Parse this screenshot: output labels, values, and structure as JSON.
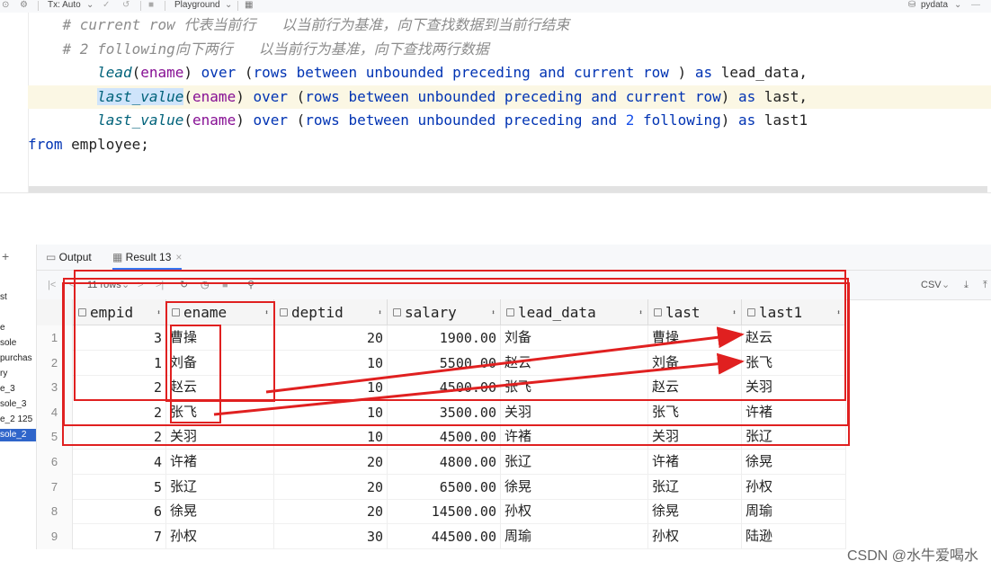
{
  "toolbar": {
    "tx_mode": "Tx: Auto",
    "playground": "Playground",
    "datasource": "pydata"
  },
  "editor": {
    "comment1": "    # current row 代表当前行   以当前行为基准，向下查找数据到当前行结束",
    "comment2": "    # 2 following向下两行   以当前行为基准，向下查找两行数据",
    "line3": {
      "fn": "lead",
      "arg": "ename",
      "kw_over": "over",
      "rows": "rows",
      "between": "between",
      "unbounded": "unbounded",
      "preceding": "preceding",
      "and": "and",
      "current_row": "current row",
      "as": "as",
      "alias": "lead_data,"
    },
    "line4": {
      "fn": "last_value",
      "arg": "ename",
      "alias": "last,"
    },
    "line5": {
      "fn": "last_value",
      "arg": "ename",
      "num": "2",
      "following": "following",
      "alias": "last1"
    },
    "line6": {
      "from": "from",
      "table": "employee;"
    }
  },
  "left_panel": {
    "items": [
      "st",
      "e",
      "sole",
      "purchas",
      "ry",
      "e_3",
      "sole_3",
      "e_2 125",
      "sole_2"
    ]
  },
  "tabs": {
    "output": "Output",
    "result": "Result 13"
  },
  "gridbar": {
    "rows": "11 rows",
    "export": "CSV"
  },
  "columns": [
    "empid",
    "ename",
    "deptid",
    "salary",
    "lead_data",
    "last",
    "last1"
  ],
  "rows": [
    {
      "n": "1",
      "empid": "3",
      "ename": "曹操",
      "deptid": "20",
      "salary": "1900.00",
      "lead_data": "刘备",
      "last": "曹操",
      "last1": "赵云"
    },
    {
      "n": "2",
      "empid": "1",
      "ename": "刘备",
      "deptid": "10",
      "salary": "5500.00",
      "lead_data": "赵云",
      "last": "刘备",
      "last1": "张飞"
    },
    {
      "n": "3",
      "empid": "2",
      "ename": "赵云",
      "deptid": "10",
      "salary": "4500.00",
      "lead_data": "张飞",
      "last": "赵云",
      "last1": "关羽"
    },
    {
      "n": "4",
      "empid": "2",
      "ename": "张飞",
      "deptid": "10",
      "salary": "3500.00",
      "lead_data": "关羽",
      "last": "张飞",
      "last1": "许褚"
    },
    {
      "n": "5",
      "empid": "2",
      "ename": "关羽",
      "deptid": "10",
      "salary": "4500.00",
      "lead_data": "许褚",
      "last": "关羽",
      "last1": "张辽"
    },
    {
      "n": "6",
      "empid": "4",
      "ename": "许褚",
      "deptid": "20",
      "salary": "4800.00",
      "lead_data": "张辽",
      "last": "许褚",
      "last1": "徐晃"
    },
    {
      "n": "7",
      "empid": "5",
      "ename": "张辽",
      "deptid": "20",
      "salary": "6500.00",
      "lead_data": "徐晃",
      "last": "张辽",
      "last1": "孙权"
    },
    {
      "n": "8",
      "empid": "6",
      "ename": "徐晃",
      "deptid": "20",
      "salary": "14500.00",
      "lead_data": "孙权",
      "last": "徐晃",
      "last1": "周瑜"
    },
    {
      "n": "9",
      "empid": "7",
      "ename": "孙权",
      "deptid": "30",
      "salary": "44500.00",
      "lead_data": "周瑜",
      "last": "孙权",
      "last1": "陆逊"
    }
  ],
  "watermark": "CSDN @水牛爱喝水",
  "colors": {
    "annotation": "#e02020",
    "selection": "#2f65ca",
    "accent": "#3574f0"
  }
}
